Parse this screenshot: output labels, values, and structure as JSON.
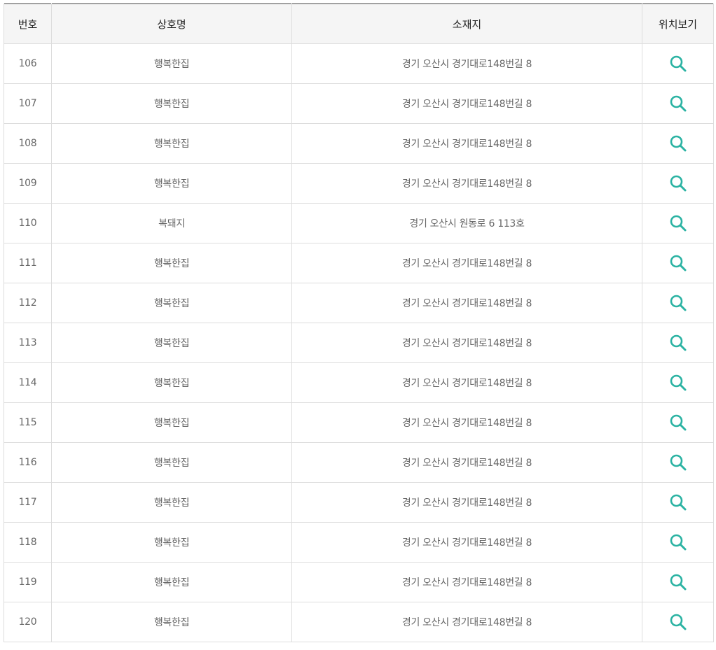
{
  "table": {
    "headers": {
      "no": "번호",
      "name": "상호명",
      "address": "소재지",
      "map": "위치보기"
    },
    "accent_color": "#2bb3a3",
    "view_icon": "search-icon",
    "rows": [
      {
        "no": "106",
        "name": "행복한집",
        "address": "경기 오산시 경기대로148번길 8"
      },
      {
        "no": "107",
        "name": "행복한집",
        "address": "경기 오산시 경기대로148번길 8"
      },
      {
        "no": "108",
        "name": "행복한집",
        "address": "경기 오산시 경기대로148번길 8"
      },
      {
        "no": "109",
        "name": "행복한집",
        "address": "경기 오산시 경기대로148번길 8"
      },
      {
        "no": "110",
        "name": "복돼지",
        "address": "경기 오산시 원동로 6 113호"
      },
      {
        "no": "111",
        "name": "행복한집",
        "address": "경기 오산시 경기대로148번길 8"
      },
      {
        "no": "112",
        "name": "행복한집",
        "address": "경기 오산시 경기대로148번길 8"
      },
      {
        "no": "113",
        "name": "행복한집",
        "address": "경기 오산시 경기대로148번길 8"
      },
      {
        "no": "114",
        "name": "행복한집",
        "address": "경기 오산시 경기대로148번길 8"
      },
      {
        "no": "115",
        "name": "행복한집",
        "address": "경기 오산시 경기대로148번길 8"
      },
      {
        "no": "116",
        "name": "행복한집",
        "address": "경기 오산시 경기대로148번길 8"
      },
      {
        "no": "117",
        "name": "행복한집",
        "address": "경기 오산시 경기대로148번길 8"
      },
      {
        "no": "118",
        "name": "행복한집",
        "address": "경기 오산시 경기대로148번길 8"
      },
      {
        "no": "119",
        "name": "행복한집",
        "address": "경기 오산시 경기대로148번길 8"
      },
      {
        "no": "120",
        "name": "행복한집",
        "address": "경기 오산시 경기대로148번길 8"
      }
    ]
  }
}
